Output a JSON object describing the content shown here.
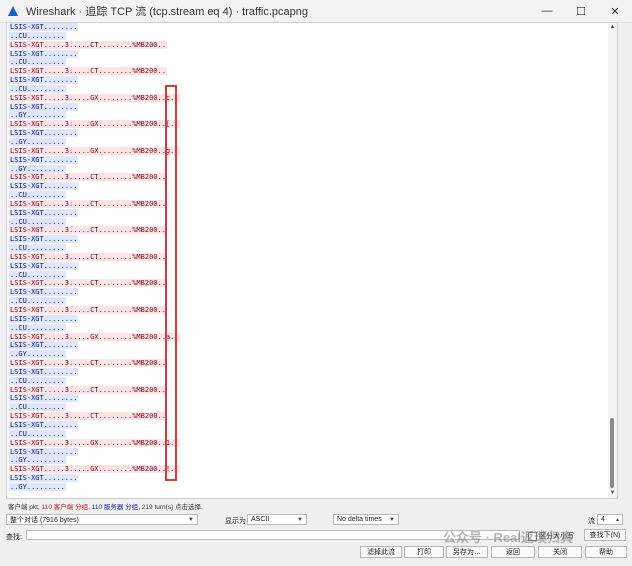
{
  "window": {
    "title": "Wireshark · 追踪 TCP 流 (tcp.stream eq 4) · traffic.pcapng",
    "minimize": "—",
    "maximize": "☐",
    "close": "✕"
  },
  "stream_lines": [
    {
      "side": "server",
      "text": "LSIS-XGT........"
    },
    {
      "side": "server",
      "text": "..CU........."
    },
    {
      "side": "client",
      "text": "LSIS-XGT.....3.....CT........%MB200.."
    },
    {
      "side": "server",
      "text": "LSIS-XGT........"
    },
    {
      "side": "server",
      "text": "..CU........."
    },
    {
      "side": "client",
      "text": "LSIS-XGT.....3.....CT........%MB200.."
    },
    {
      "side": "server",
      "text": "LSIS-XGT........"
    },
    {
      "side": "server",
      "text": "..CU........."
    },
    {
      "side": "client",
      "text": "LSIS-XGT.....3.....GX........%MB200..c.."
    },
    {
      "side": "server",
      "text": "LSIS-XGT........"
    },
    {
      "side": "server",
      "text": "..GY........."
    },
    {
      "side": "client",
      "text": "LSIS-XGT.....3.....GX........%MB200..[.."
    },
    {
      "side": "server",
      "text": "LSIS-XGT........"
    },
    {
      "side": "server",
      "text": "..GY........."
    },
    {
      "side": "client",
      "text": "LSIS-XGT.....3.....GX........%MB200..g.."
    },
    {
      "side": "server",
      "text": "LSIS-XGT........"
    },
    {
      "side": "server",
      "text": "..GY........."
    },
    {
      "side": "client",
      "text": "LSIS-XGT.....3.....CT........%MB200.."
    },
    {
      "side": "server",
      "text": "LSIS-XGT........"
    },
    {
      "side": "server",
      "text": "..CU........."
    },
    {
      "side": "client",
      "text": "LSIS-XGT.....3.....CT........%MB200.."
    },
    {
      "side": "server",
      "text": "LSIS-XGT........"
    },
    {
      "side": "server",
      "text": "..CU........."
    },
    {
      "side": "client",
      "text": "LSIS-XGT.....3.....CT........%MB200.."
    },
    {
      "side": "server",
      "text": "LSIS-XGT........"
    },
    {
      "side": "server",
      "text": "..CU........."
    },
    {
      "side": "client",
      "text": "LSIS-XGT.....3.....CT........%MB200.."
    },
    {
      "side": "server",
      "text": "LSIS-XGT........"
    },
    {
      "side": "server",
      "text": "..CU........."
    },
    {
      "side": "client",
      "text": "LSIS-XGT.....3.....CT........%MB200.."
    },
    {
      "side": "server",
      "text": "LSIS-XGT........"
    },
    {
      "side": "server",
      "text": "..CU........."
    },
    {
      "side": "client",
      "text": "LSIS-XGT.....3.....CT........%MB200.."
    },
    {
      "side": "server",
      "text": "LSIS-XGT........"
    },
    {
      "side": "server",
      "text": "..CU........."
    },
    {
      "side": "client",
      "text": "LSIS-XGT.....3.....GX........%MB200..a.."
    },
    {
      "side": "server",
      "text": "LSIS-XGT........"
    },
    {
      "side": "server",
      "text": "..GY........."
    },
    {
      "side": "client",
      "text": "LSIS-XGT.....3.....CT........%MB200.."
    },
    {
      "side": "server",
      "text": "LSIS-XGT........"
    },
    {
      "side": "server",
      "text": "..CU........."
    },
    {
      "side": "client",
      "text": "LSIS-XGT.....3.....CT........%MB200.."
    },
    {
      "side": "server",
      "text": "LSIS-XGT........"
    },
    {
      "side": "server",
      "text": "..CU........."
    },
    {
      "side": "client",
      "text": "LSIS-XGT.....3.....CT........%MB200.."
    },
    {
      "side": "server",
      "text": "LSIS-XGT........"
    },
    {
      "side": "server",
      "text": "..CU........."
    },
    {
      "side": "client",
      "text": "LSIS-XGT.....3.....GX........%MB200..1.."
    },
    {
      "side": "server",
      "text": "LSIS-XGT........"
    },
    {
      "side": "server",
      "text": "..GY........."
    },
    {
      "side": "client",
      "text": "LSIS-XGT.....3.....GX........%MB200..!.."
    },
    {
      "side": "server",
      "text": "LSIS-XGT........"
    },
    {
      "side": "server",
      "text": "..GY........."
    }
  ],
  "status": {
    "prefix": "客户端 pkt, ",
    "client_part": "110 客户端 分组",
    "middle": ", ",
    "server_part": "110 服务器 分组",
    "suffix": ", 219 turn(s) 点击选择."
  },
  "controls": {
    "conversation": "整个对话 (7916 bytes)",
    "show_as_label": "显示为",
    "show_as": "ASCII",
    "delta": "No delta times",
    "stream_label": "流",
    "stream_value": "4"
  },
  "find": {
    "label": "查找:",
    "placeholder": "",
    "case_sensitive": "区分大小写",
    "find_next": "查找下(N)"
  },
  "buttons": {
    "filter_out": "滤掉此流",
    "print": "打印",
    "save_as": "另存为…",
    "back": "返回",
    "close": "关闭",
    "help": "帮助"
  },
  "watermark": "公众号 · Real返璞归真",
  "colors": {
    "client_bg": "#fbe3e6",
    "server_bg": "#dfe6ff",
    "highlight_box": "#e23535"
  }
}
